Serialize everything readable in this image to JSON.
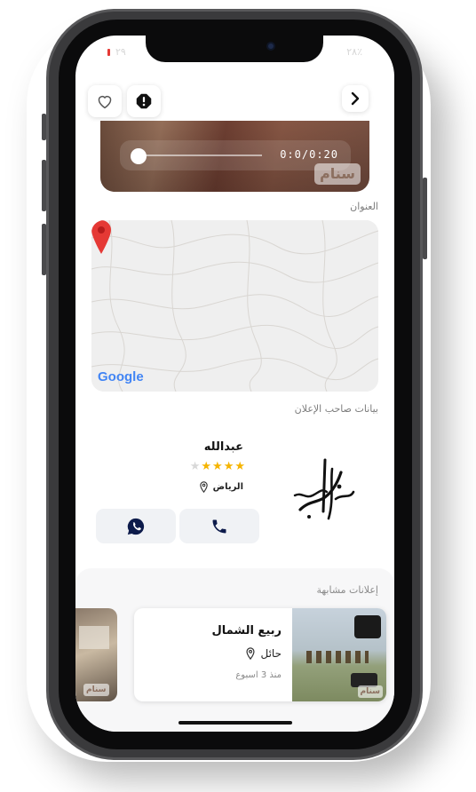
{
  "status": {
    "left_text": "٢٩",
    "right_text": "٢٨٪"
  },
  "media": {
    "time": "0:0/0:20",
    "watermark": "سنام"
  },
  "address_label": "العنوان",
  "map": {
    "attribution": "Google"
  },
  "seller_section_label": "بيانات صاحب الإعلان",
  "seller": {
    "name": "عبدالله",
    "rating": 4,
    "rating_max": 5,
    "location": "الرياض",
    "logo_text": "عبدالله"
  },
  "similar_label": "إعلانات مشابهة",
  "similar": [
    {
      "title": "ربيع الشمال",
      "location": "حائل",
      "time": "منذ 3 اسبوع",
      "watermark": "سنام"
    },
    {
      "watermark": "سنام"
    }
  ],
  "colors": {
    "accent": "#0d1b4b",
    "star": "#f5b400",
    "pin": "#e53935"
  }
}
